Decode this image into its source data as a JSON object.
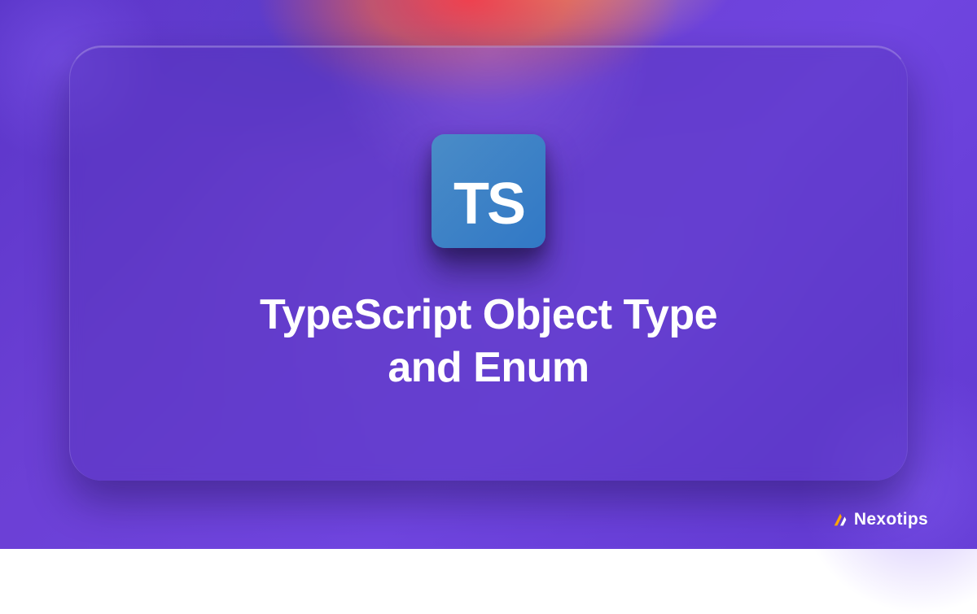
{
  "logo": {
    "text": "TS"
  },
  "title": {
    "line1": "TypeScript Object Type",
    "line2": "and Enum"
  },
  "brand": {
    "name": "Nexotips"
  }
}
